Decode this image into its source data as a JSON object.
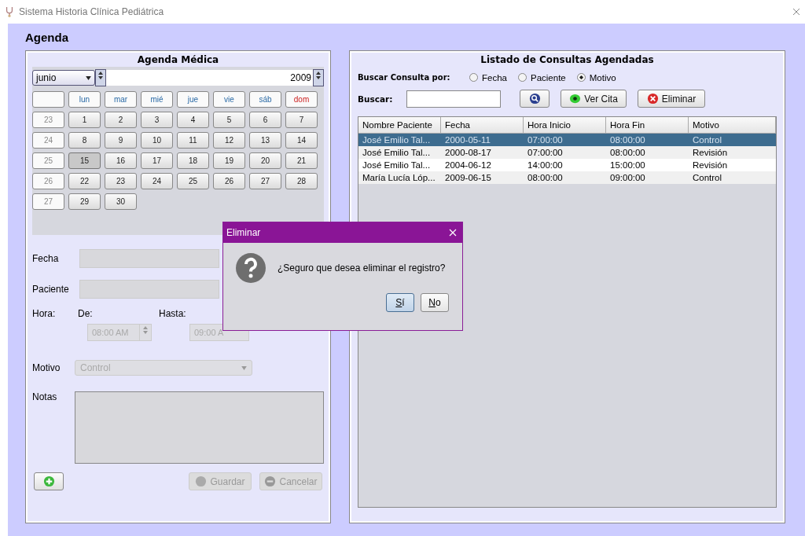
{
  "window": {
    "title": "Sistema Historia Clínica Pediátrica"
  },
  "header": "Agenda",
  "calendar_panel": {
    "title": "Agenda Médica",
    "month": "junio",
    "year": "2009",
    "weekdays": [
      {
        "label": "lun",
        "kind": "weekday"
      },
      {
        "label": "mar",
        "kind": "weekday"
      },
      {
        "label": "mié",
        "kind": "weekday"
      },
      {
        "label": "jue",
        "kind": "weekday"
      },
      {
        "label": "vie",
        "kind": "weekday"
      },
      {
        "label": "sáb",
        "kind": "weekday"
      },
      {
        "label": "dom",
        "kind": "sunday"
      }
    ],
    "weeks": [
      {
        "week": "23",
        "days": [
          {
            "label": "1",
            "selected": false
          },
          {
            "label": "2",
            "selected": false
          },
          {
            "label": "3",
            "selected": false
          },
          {
            "label": "4",
            "selected": false
          },
          {
            "label": "5",
            "selected": false
          },
          {
            "label": "6",
            "selected": false
          },
          {
            "label": "7",
            "selected": false
          }
        ]
      },
      {
        "week": "24",
        "days": [
          {
            "label": "8",
            "selected": false
          },
          {
            "label": "9",
            "selected": false
          },
          {
            "label": "10",
            "selected": false
          },
          {
            "label": "11",
            "selected": false
          },
          {
            "label": "12",
            "selected": false
          },
          {
            "label": "13",
            "selected": false
          },
          {
            "label": "14",
            "selected": false
          }
        ]
      },
      {
        "week": "25",
        "days": [
          {
            "label": "15",
            "selected": true
          },
          {
            "label": "16",
            "selected": false
          },
          {
            "label": "17",
            "selected": false
          },
          {
            "label": "18",
            "selected": false
          },
          {
            "label": "19",
            "selected": false
          },
          {
            "label": "20",
            "selected": false
          },
          {
            "label": "21",
            "selected": false
          }
        ]
      },
      {
        "week": "26",
        "days": [
          {
            "label": "22",
            "selected": false
          },
          {
            "label": "23",
            "selected": false
          },
          {
            "label": "24",
            "selected": false
          },
          {
            "label": "25",
            "selected": false
          },
          {
            "label": "26",
            "selected": false
          },
          {
            "label": "27",
            "selected": false
          },
          {
            "label": "28",
            "selected": false
          }
        ]
      },
      {
        "week": "27",
        "days": [
          {
            "label": "29",
            "selected": false
          },
          {
            "label": "30",
            "selected": false
          }
        ]
      }
    ],
    "form": {
      "fecha_label": "Fecha",
      "paciente_label": "Paciente",
      "hora_label": "Hora:",
      "de_label": "De:",
      "hasta_label": "Hasta:",
      "de_value": "08:00 AM",
      "hasta_value": "09:00 A",
      "motivo_label": "Motivo",
      "motivo_value": "Control",
      "notas_label": "Notas",
      "disabled": true
    },
    "buttons": [
      {
        "kind": "add"
      },
      {
        "kind": "save",
        "label": "Guardar",
        "disabled": true
      },
      {
        "kind": "cancel",
        "label": "Cancelar",
        "disabled": true
      }
    ]
  },
  "list_panel": {
    "title": "Listado de Consultas Agendadas",
    "search_by_label": "Buscar Consulta por:",
    "radios": [
      {
        "label": "Fecha",
        "selected": false
      },
      {
        "label": "Paciente",
        "selected": false
      },
      {
        "label": "Motivo",
        "selected": true
      }
    ],
    "search_label": "Buscar:",
    "buttons": [
      {
        "kind": "search"
      },
      {
        "kind": "view",
        "label": "Ver Cita"
      },
      {
        "kind": "delete",
        "label": "Eliminar"
      }
    ],
    "table": {
      "columns": [
        "Nombre Paciente",
        "Fecha",
        "Hora Inicio",
        "Hora Fin",
        "Motivo"
      ],
      "rows": [
        {
          "cells": [
            "José Emilio Tal...",
            "2000-05-11",
            "07:00:00",
            "08:00:00",
            "Control"
          ],
          "selected": true
        },
        {
          "cells": [
            "José Emilio Tal...",
            "2000-08-17",
            "07:00:00",
            "08:00:00",
            "Revisión"
          ],
          "selected": false
        },
        {
          "cells": [
            "José Emilio Tal...",
            "2004-06-12",
            "14:00:00",
            "15:00:00",
            "Revisión"
          ],
          "selected": false
        },
        {
          "cells": [
            "María Lucía Lóp...",
            "2009-06-15",
            "08:00:00",
            "09:00:00",
            "Control"
          ],
          "selected": false
        }
      ]
    }
  },
  "dialog": {
    "title": "Eliminar",
    "message": "¿Seguro que desea eliminar el registro?",
    "buttons": [
      {
        "label": "Sí",
        "default": true
      },
      {
        "label": "No",
        "default": false
      }
    ]
  }
}
